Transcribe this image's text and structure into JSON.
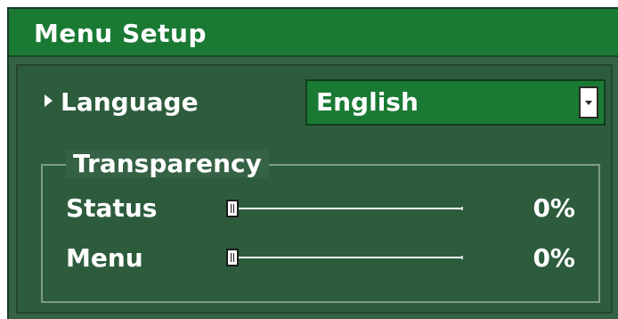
{
  "dialog": {
    "title": "Menu Setup"
  },
  "language": {
    "label": "Language",
    "value": "English"
  },
  "transparency": {
    "legend": "Transparency",
    "status": {
      "label": "Status",
      "value_text": "0%",
      "level_percent": 0
    },
    "menu": {
      "label": "Menu",
      "value_text": "0%",
      "level_percent": 0
    }
  },
  "colors": {
    "panel_background": "#356144",
    "title_bar": "#1a7a34",
    "select_background": "#1a7a34",
    "text": "#ffffff",
    "group_border": "#7d9c86"
  },
  "icons": {
    "selection_marker": "triangle-right-icon",
    "dropdown": "chevron-down-icon"
  }
}
